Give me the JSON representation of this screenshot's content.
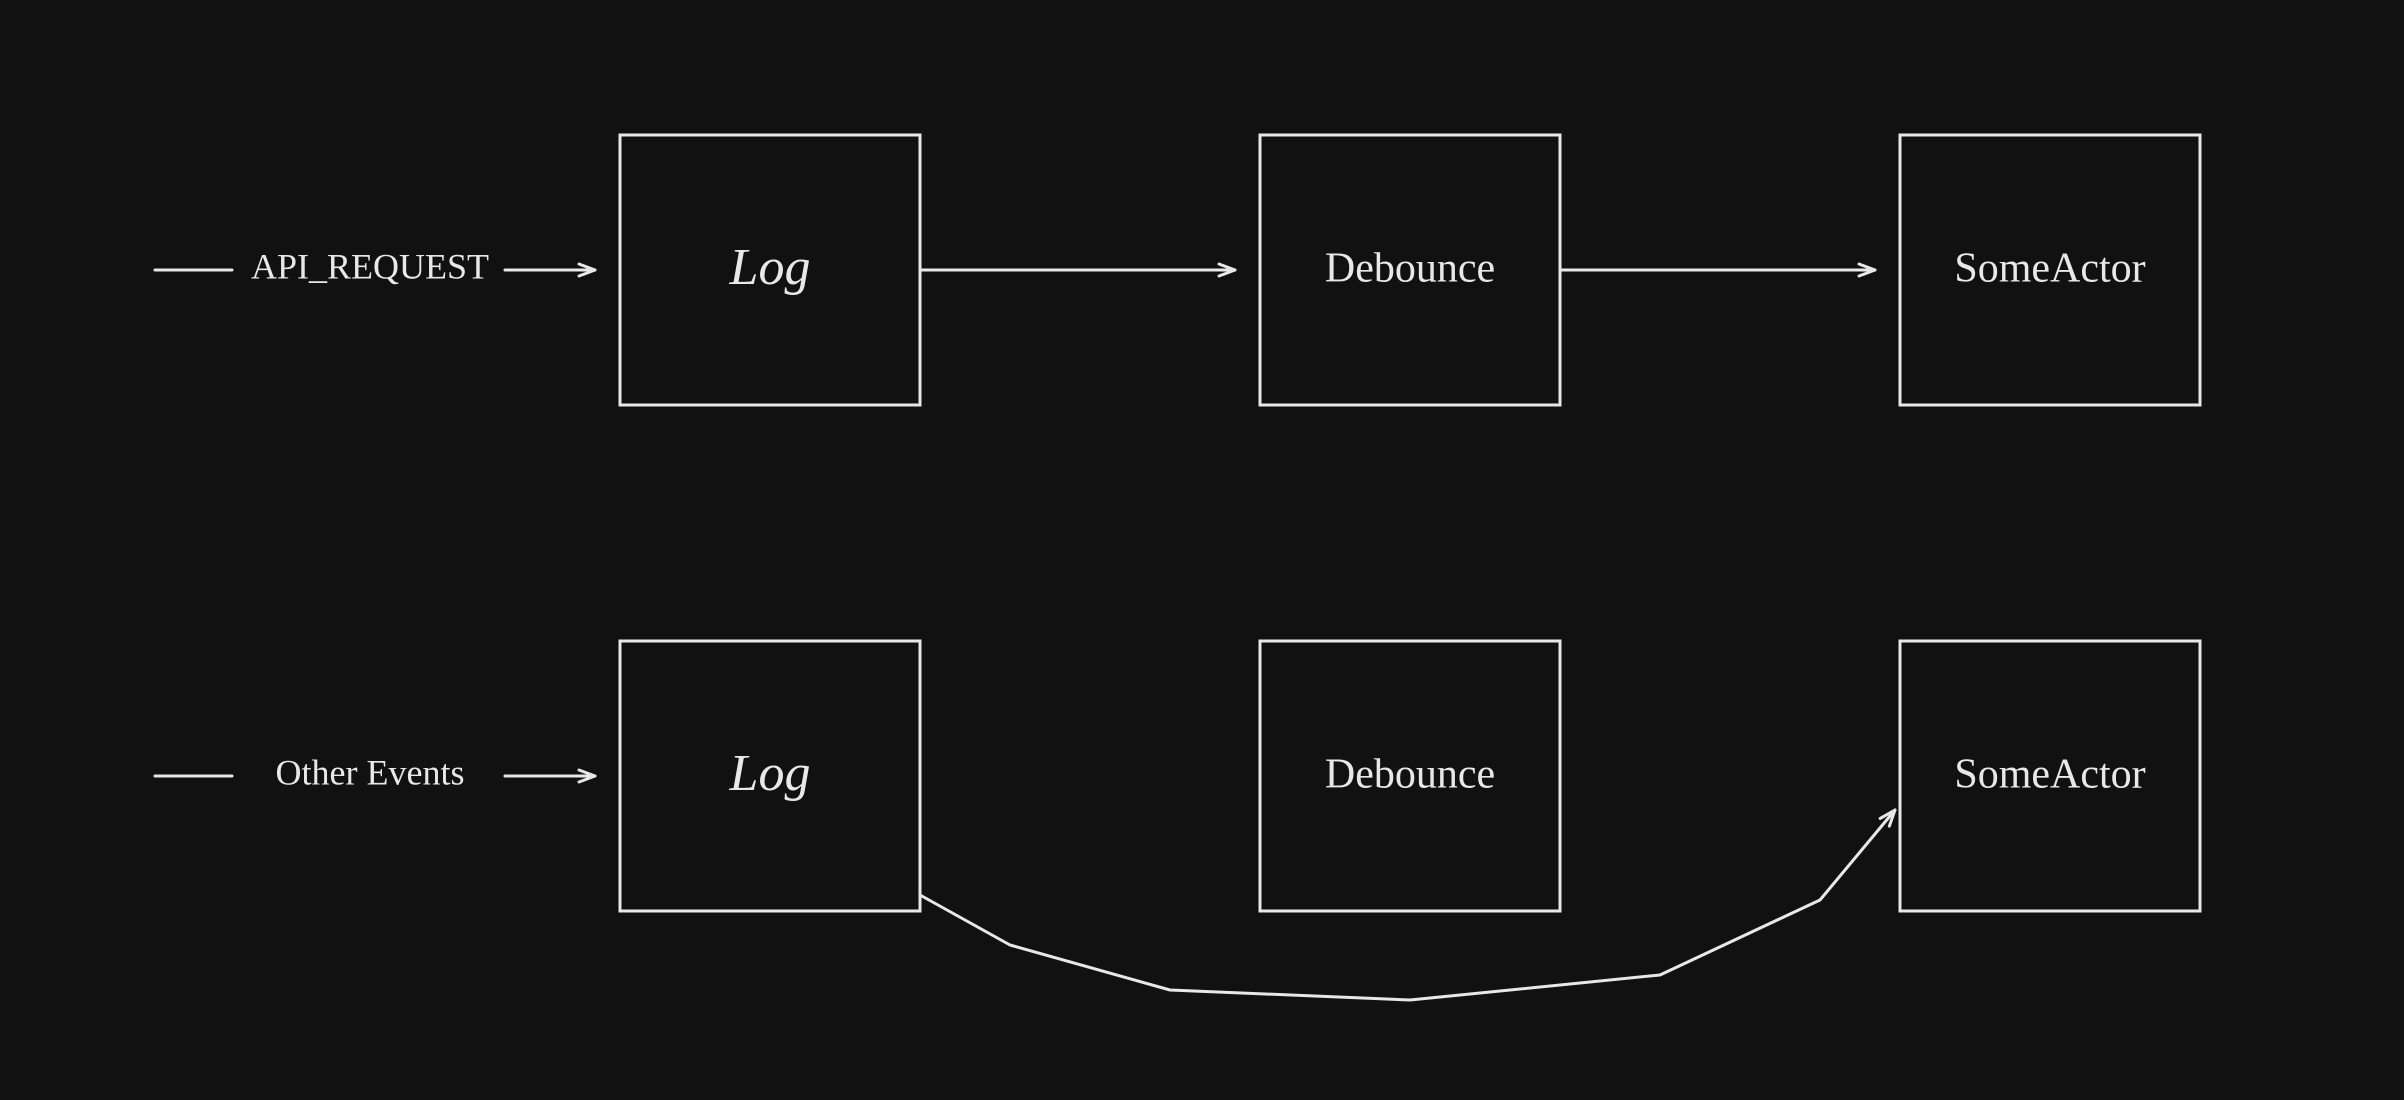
{
  "flows": [
    {
      "input_label": "API_REQUEST",
      "nodes": [
        "Log",
        "Debounce",
        "SomeActor"
      ],
      "bypass_debounce": false
    },
    {
      "input_label": "Other Events",
      "nodes": [
        "Log",
        "Debounce",
        "SomeActor"
      ],
      "bypass_debounce": true
    }
  ],
  "colors": {
    "background": "#111111",
    "stroke": "#e8e8e8"
  }
}
